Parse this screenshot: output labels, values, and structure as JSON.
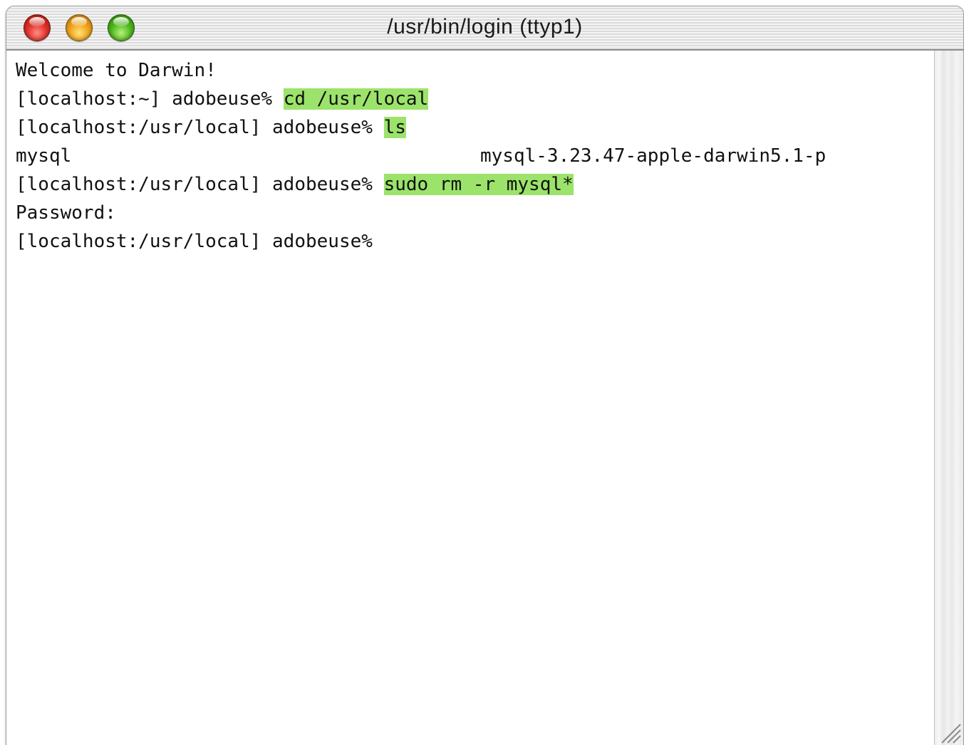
{
  "window": {
    "title": "/usr/bin/login  (ttyp1)"
  },
  "terminal": {
    "line1": "Welcome to Darwin!",
    "line2_prompt": "[localhost:~] adobeuse% ",
    "line2_cmd": "cd /usr/local",
    "line3_prompt": "[localhost:/usr/local] adobeuse% ",
    "line3_cmd": "ls",
    "line4_col1": "mysql",
    "line4_col2": "mysql-3.23.47-apple-darwin5.1-p",
    "line5_prompt": "[localhost:/usr/local] adobeuse% ",
    "line5_cmd": "sudo rm -r mysql*",
    "line6": "Password:",
    "line7_prompt": "[localhost:/usr/local] adobeuse%"
  },
  "colors": {
    "highlight": "#9be36a",
    "close": "#e0322a",
    "minimize": "#f0a21a",
    "zoom": "#4fb81e"
  },
  "icons": {
    "close": "close-button-icon",
    "minimize": "minimize-button-icon",
    "zoom": "zoom-button-icon",
    "resize": "resize-grip-icon"
  }
}
